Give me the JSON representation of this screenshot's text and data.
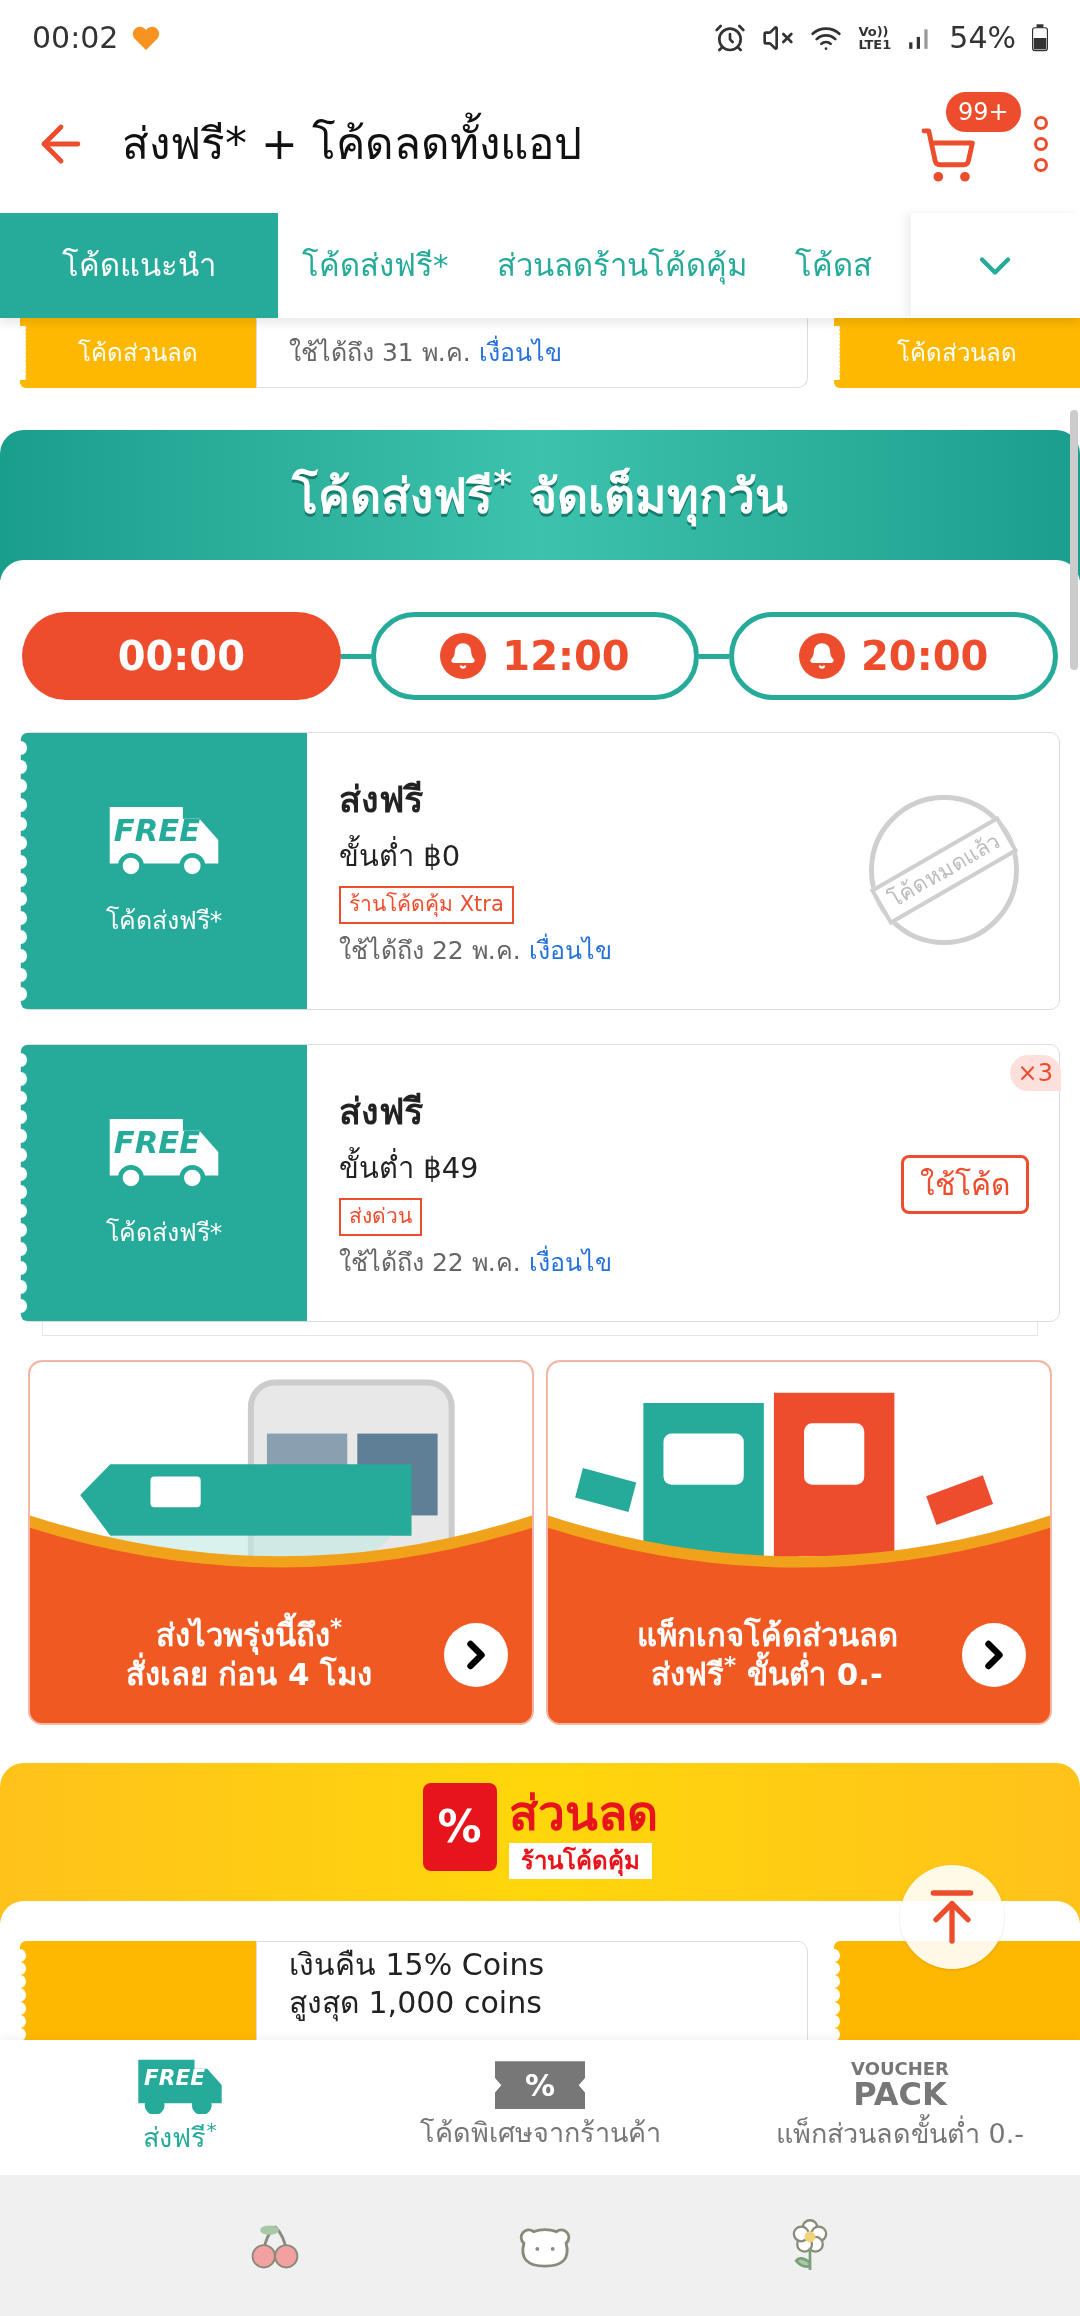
{
  "status_bar": {
    "time": "00:02",
    "volte": "Vo))",
    "lte": "LTE1",
    "battery": "54%"
  },
  "header": {
    "title": "ส่งฟรี* + โค้ดลดทั้งแอป",
    "cart_badge": "99+"
  },
  "tabs": [
    {
      "label": "โค้ดแนะนำ",
      "selected": true
    },
    {
      "label": "โค้ดส่งฟรี*",
      "selected": false
    },
    {
      "label": "ส่วนลดร้านโค้ดคุ้ม",
      "selected": false
    },
    {
      "label": "โค้ดส",
      "selected": false
    }
  ],
  "top_partial_voucher": {
    "stub_label": "โค้ดส่วนลด",
    "valid_until": "ใช้ได้ถึง 31 พ.ค.",
    "terms_link": "เงื่อนไข",
    "next_stub_label": "โค้ดส่วนลด"
  },
  "free_shipping_section": {
    "banner_title": "โค้ดส่งฟรี$^{*}$ จัดเต็มทุกวัน",
    "time_slots": [
      {
        "time": "00:00",
        "selected": true,
        "reminder": false
      },
      {
        "time": "12:00",
        "selected": false,
        "reminder": true
      },
      {
        "time": "20:00",
        "selected": false,
        "reminder": true
      }
    ],
    "vouchers": [
      {
        "badge_text": "FREE",
        "stub_label": "โค้ดส่งฟรี*",
        "title": "ส่งฟรี",
        "min_spend": "ขั้นต่ำ ฿0",
        "tag": "ร้านโค้ดคุ้ม Xtra",
        "valid_until": "ใช้ได้ถึง 22 พ.ค.",
        "terms_link": "เงื่อนไข",
        "kind": "used_up",
        "stamp": "โค้ดหมดแล้ว"
      },
      {
        "badge_text": "FREE",
        "stub_label": "โค้ดส่งฟรี*",
        "title": "ส่งฟรี",
        "min_spend": "ขั้นต่ำ ฿49",
        "tag": "ส่งด่วน",
        "valid_until": "ใช้ได้ถึง 22 พ.ค.",
        "terms_link": "เงื่อนไข",
        "kind": "available",
        "action": "ใช้โค้ด",
        "quantity": "×3"
      }
    ]
  },
  "promos": [
    {
      "line1": "ส่งไวพรุ่งนี้ถึง$^{*}$",
      "line2": "สั่งเลย ก่อน 4 โมง"
    },
    {
      "line1": "แพ็กเกจโค้ดส่วนลด",
      "line2": "ส่งฟรี$^{*}$ ขั้นต่ำ 0.-"
    }
  ],
  "shop_discount_section": {
    "banner_icon": "%",
    "banner_title": "ส่วนลด",
    "banner_subtitle": "ร้านโค้ดคุ้ม",
    "voucher_line1": "เงินคืน 15% Coins",
    "voucher_line2": "สูงสุด 1,000 coins"
  },
  "bottom_tabs": [
    {
      "kind": "free",
      "icon_lines": [
        "FREE"
      ],
      "label": "ส่งฟรี$^{*}$",
      "selected": true
    },
    {
      "kind": "ticket",
      "icon_lines": [
        "%"
      ],
      "label": "โค้ดพิเศษจากร้านค้า",
      "selected": false
    },
    {
      "kind": "pack",
      "icon_lines": [
        "VOUCHER",
        "PACK"
      ],
      "label": "แพ็กส่วนลดขั้นต่ำ 0.-",
      "selected": false
    }
  ]
}
